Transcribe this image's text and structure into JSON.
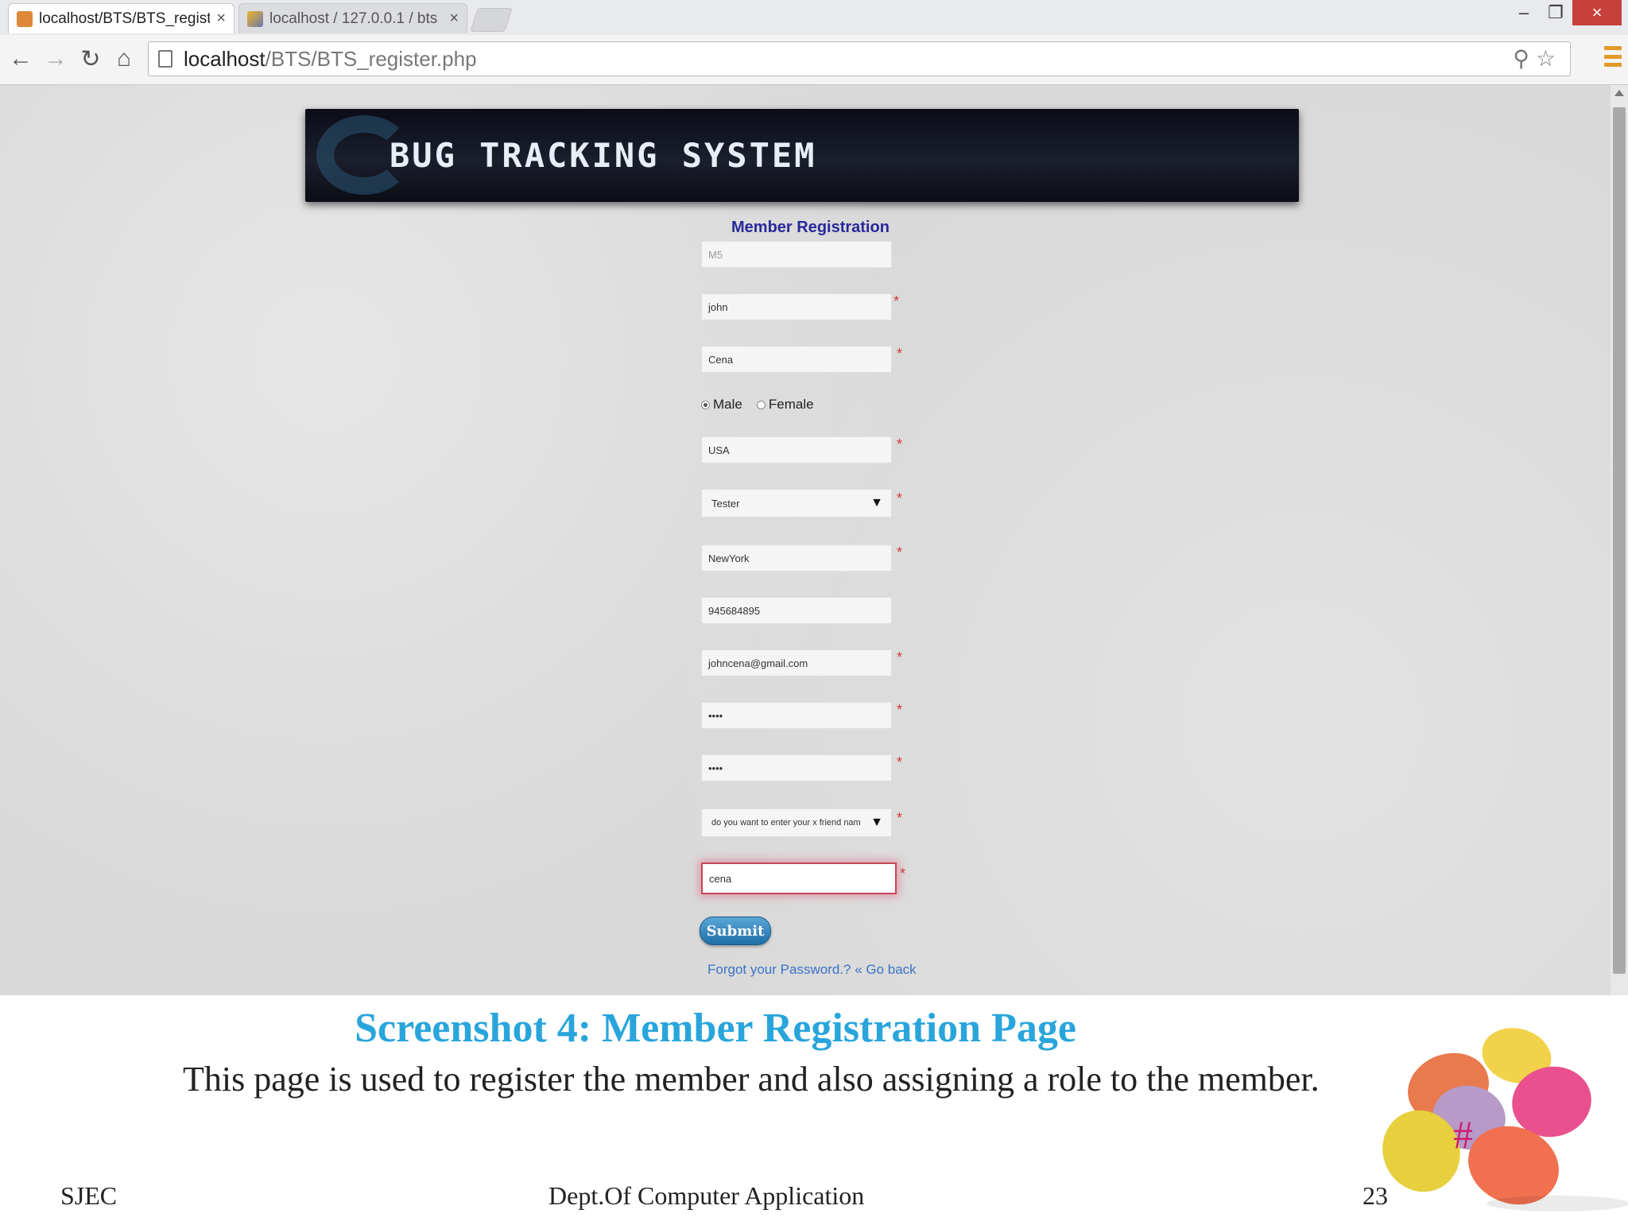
{
  "browser": {
    "tabs": [
      {
        "title": "localhost/BTS/BTS_register",
        "close": "×",
        "active": true
      },
      {
        "title": "localhost / 127.0.0.1 / bts",
        "close": "×",
        "active": false
      }
    ],
    "window_controls": {
      "minimize": "–",
      "restore": "❐",
      "close": "×"
    },
    "nav": {
      "back": "←",
      "forward": "→",
      "reload": "↻",
      "home": "⌂"
    },
    "url_host": "localhost",
    "url_path": "/BTS/BTS_register.php",
    "omnibox_icons": "⚲☆",
    "accent_colors": {
      "menu": "#e39a2a",
      "close_button": "#c7413a"
    }
  },
  "page": {
    "banner_title": "BUG TRACKING SYSTEM",
    "form_heading": "Member Registration",
    "fields": {
      "member_id": "M5",
      "first_name": "john",
      "last_name": "Cena",
      "country": "USA",
      "city": "NewYork",
      "phone": "945684895",
      "email": "johncena@gmail.com",
      "password": "••••",
      "confirm_password": "••••",
      "security_answer": "cena"
    },
    "required_marker": "*",
    "gender": {
      "male_label": "Male",
      "female_label": "Female",
      "selected": "Male"
    },
    "role_select": {
      "selected": "Tester",
      "caret": "▼"
    },
    "security_question_select": {
      "selected": "do you want to enter your x friend nam",
      "caret": "▼"
    },
    "submit_label": "Submit",
    "links": {
      "forgot": "Forgot your Password.?",
      "separator": " « ",
      "go_back": "Go back"
    }
  },
  "slide": {
    "caption_title": "Screenshot 4: Member Registration Page",
    "caption_body": "This page is used to register the member and also assigning a role to the member.",
    "footer_left": "SJEC",
    "footer_center": "Dept.Of Computer Application",
    "page_number": "23",
    "hash_mark": "#",
    "colors": {
      "caption": "#29a5dc",
      "hash": "#cc1f6d"
    }
  }
}
